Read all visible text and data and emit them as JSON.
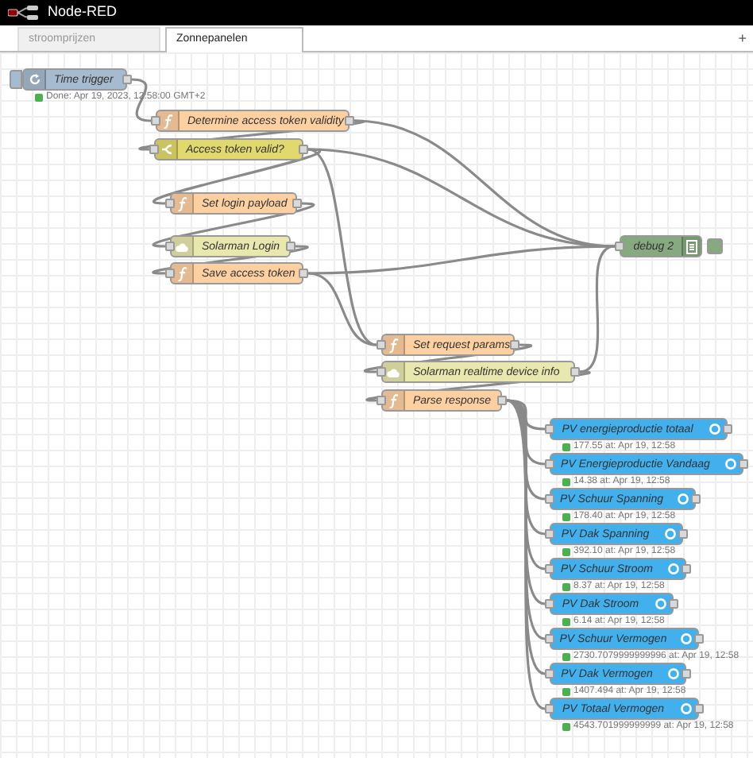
{
  "app": {
    "title": "Node-RED"
  },
  "tabs": [
    {
      "label": "stroomprijzen",
      "selected": false
    },
    {
      "label": "Zonnepanelen",
      "selected": true
    }
  ],
  "add_tab": "+",
  "nodes": [
    {
      "kind": "inject",
      "label": "Time trigger",
      "status": "Done: Apr 19, 2023, 12:58:00 GMT+2"
    },
    {
      "kind": "function",
      "label": "Determine access token validity"
    },
    {
      "kind": "switch",
      "label": "Access token valid?"
    },
    {
      "kind": "function",
      "label": "Set login payload"
    },
    {
      "kind": "http",
      "label": "Solarman Login"
    },
    {
      "kind": "function",
      "label": "Save access token"
    },
    {
      "kind": "debug",
      "label": "debug 2",
      "active": true
    },
    {
      "kind": "function",
      "label": "Set request params"
    },
    {
      "kind": "http",
      "label": "Solarman realtime device info"
    },
    {
      "kind": "function",
      "label": "Parse response"
    },
    {
      "kind": "ui",
      "label": "PV energieproductie totaal",
      "status": "177.55 at: Apr 19, 12:58"
    },
    {
      "kind": "ui",
      "label": "PV Energieproductie Vandaag",
      "status": "14.38 at: Apr 19, 12:58"
    },
    {
      "kind": "ui",
      "label": "PV Schuur Spanning",
      "status": "178.40 at: Apr 19, 12:58"
    },
    {
      "kind": "ui",
      "label": "PV Dak Spanning",
      "status": "392.10 at: Apr 19, 12:58"
    },
    {
      "kind": "ui",
      "label": "PV Schuur Stroom",
      "status": "8.37 at: Apr 19, 12:58"
    },
    {
      "kind": "ui",
      "label": "PV Dak Stroom",
      "status": "6.14 at: Apr 19, 12:58"
    },
    {
      "kind": "ui",
      "label": "PV Schuur Vermogen",
      "status": "2730.7079999999996 at: Apr 19, 12:58"
    },
    {
      "kind": "ui",
      "label": "PV Dak Vermogen",
      "status": "1407.494 at: Apr 19, 12:58"
    },
    {
      "kind": "ui",
      "label": "PV Totaal Vermogen",
      "status": "4543.701999999999 at: Apr 19, 12:58"
    }
  ]
}
